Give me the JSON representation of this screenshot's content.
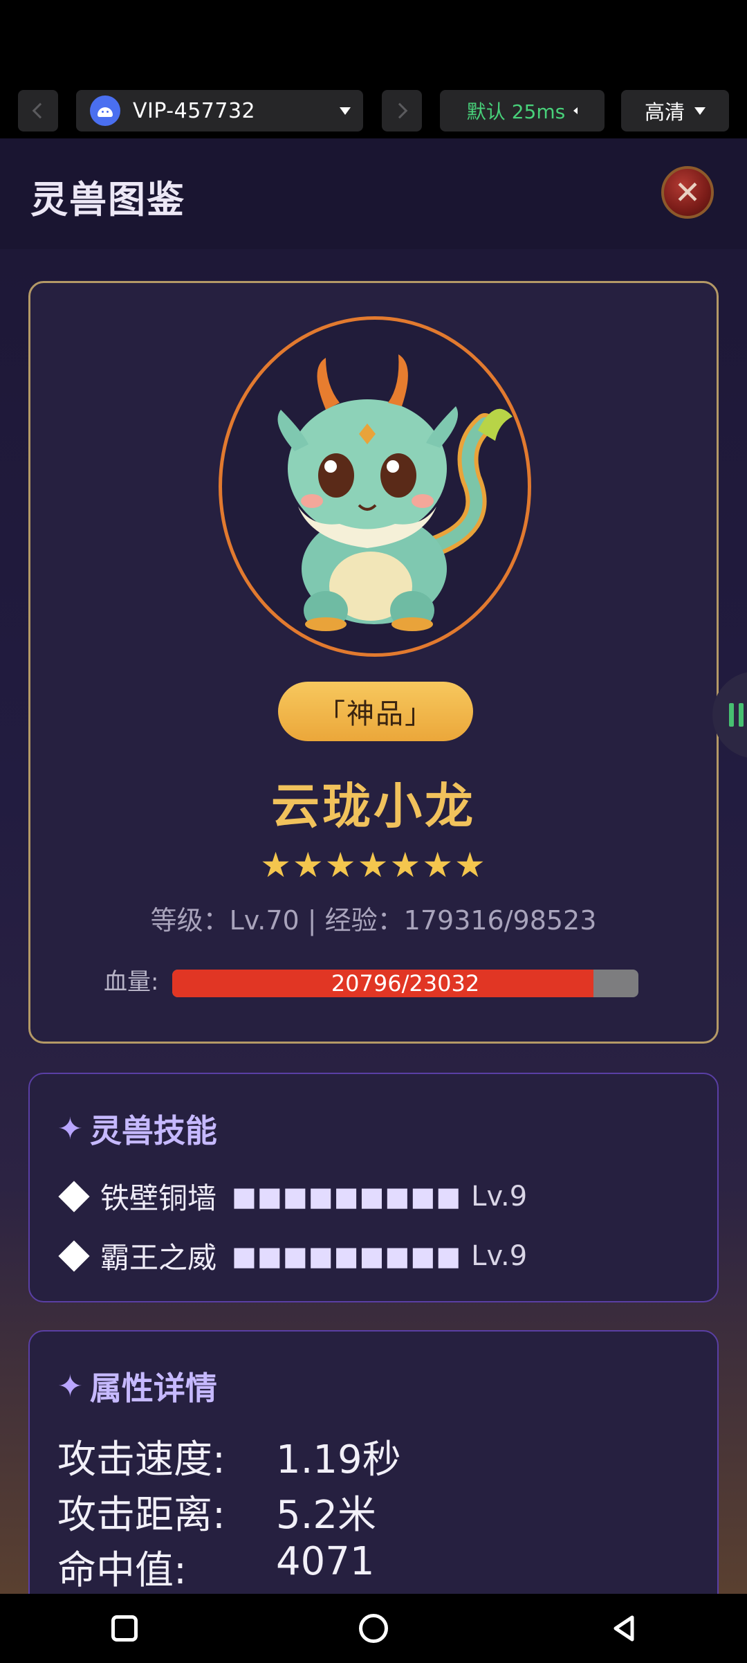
{
  "toolbar": {
    "device_name": "VIP-457732",
    "network_label": "默认 25ms",
    "quality_label": "高清"
  },
  "header": {
    "title": "灵兽图鉴"
  },
  "pet": {
    "rarity": "「神品」",
    "name": "云珑小龙",
    "stars": "★★★★★★★",
    "star_count": 7,
    "level_exp": "等级：Lv.70 | 经验：179316/98523",
    "hp_label": "血量:",
    "hp_text": "20796/23032",
    "hp_current": 20796,
    "hp_max": 23032
  },
  "skills": {
    "title": "灵兽技能",
    "items": [
      {
        "name": "铁壁铜墙",
        "blocks": "■■■■■■■■■",
        "level": "Lv.9"
      },
      {
        "name": "霸王之威",
        "blocks": "■■■■■■■■■",
        "level": "Lv.9"
      }
    ]
  },
  "attributes": {
    "title": "属性详情",
    "items": [
      {
        "label": "攻击速度:",
        "value": "1.19秒"
      },
      {
        "label": "攻击距离:",
        "value": "5.2米"
      },
      {
        "label": "命中值:",
        "value": "4071"
      }
    ]
  },
  "colors": {
    "accent_gold": "#f1c25c",
    "hp_red": "#e13624",
    "skill_purple": "#c6b9ff",
    "network_green": "#48d17a"
  }
}
